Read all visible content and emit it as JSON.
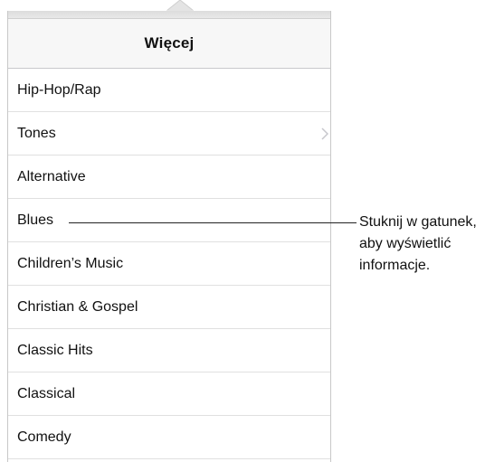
{
  "popover": {
    "title": "Więcej",
    "items": [
      {
        "label": "Hip-Hop/Rap"
      },
      {
        "label": "Tones"
      },
      {
        "label": "Alternative"
      },
      {
        "label": "Blues"
      },
      {
        "label": "Children’s Music"
      },
      {
        "label": "Christian & Gospel"
      },
      {
        "label": "Classic Hits"
      },
      {
        "label": "Classical"
      },
      {
        "label": "Comedy"
      }
    ],
    "chevron_icon": "chevron-right-icon"
  },
  "callout": {
    "lines": [
      "Stuknij w gatunek,",
      "aby wyświetlić",
      "informacje."
    ]
  },
  "colors": {
    "separator": "#e0e0e0",
    "header_bg": "#f7f7f7",
    "text": "#111111"
  }
}
